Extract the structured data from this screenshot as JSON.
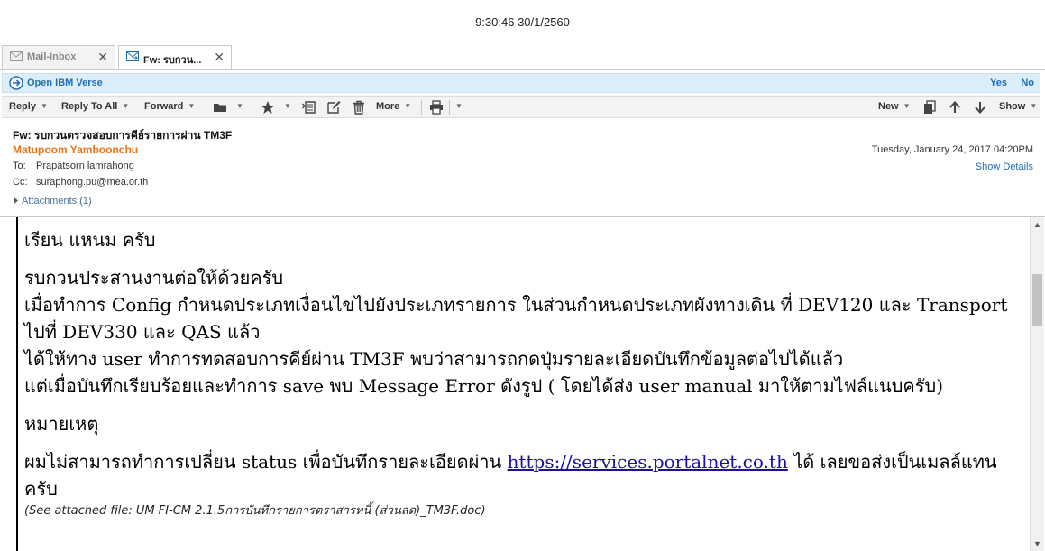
{
  "status_bar": {
    "clock": "9:30:46 30/1/2560"
  },
  "tabs": [
    {
      "label": "Mail-Inbox",
      "icon": "mail-icon",
      "close": "✕"
    },
    {
      "label": "Fw: รบกวน...",
      "icon": "forward-mail-icon",
      "close": "✕"
    }
  ],
  "verse_bar": {
    "label": "Open IBM Verse",
    "yes": "Yes",
    "no": "No",
    "icon": "verse-icon"
  },
  "toolbar": {
    "reply": "Reply",
    "reply_all": "Reply To All",
    "forward": "Forward",
    "more": "More",
    "new": "New",
    "show": "Show",
    "caret": "▼"
  },
  "message": {
    "subject": "Fw: รบกวนตรวจสอบการคีย์รายการผ่าน TM3F",
    "sender": "Matupoom Yamboonchu",
    "to_label": "To:",
    "to": "Prapatsorn lamrahong",
    "cc_label": "Cc:",
    "cc": "suraphong.pu@mea.or.th",
    "attachments": "Attachments (1)",
    "date": "Tuesday, January 24, 2017 04:20PM",
    "show_details": "Show Details"
  },
  "body": {
    "greeting": "เรียน แหนม ครับ",
    "line1": "รบกวนประสานงานต่อให้ด้วยครับ",
    "line2": "เมื่อทำการ Config กำหนดประเภทเงื่อนไขไปยังประเภทรายการ ในส่วนกำหนดประเภทผังทางเดิน ที่ DEV120 และ Transport ไปที่ DEV330 และ QAS แล้ว",
    "line3": "ได้ให้ทาง user ทำการทดสอบการคีย์ผ่าน TM3F พบว่าสามารถกดปุ่มรายละเอียดบันทึกข้อมูลต่อไปได้แล้ว",
    "line4": "แต่เมื่อบันทึกเรียบร้อยและทำการ save พบ Message Error ดังรูป ( โดยได้ส่ง user manual มาให้ตามไฟล์แนบครับ)",
    "remark": "หมายเหตุ",
    "line5_a": "ผมไม่สามารถทำการเปลี่ยน status เพื่อบันทึกรายละเอียดผ่าน ",
    "link": "https://services.portalnet.co.th",
    "line5_b": " ได้ เลยขอส่งเป็นเมลล์แทนครับ",
    "attached_note": "(See attached file: UM FI-CM 2.1.5การบันทึกรายการตราสารหนี้ (ส่วนลด)_TM3F.doc)"
  }
}
